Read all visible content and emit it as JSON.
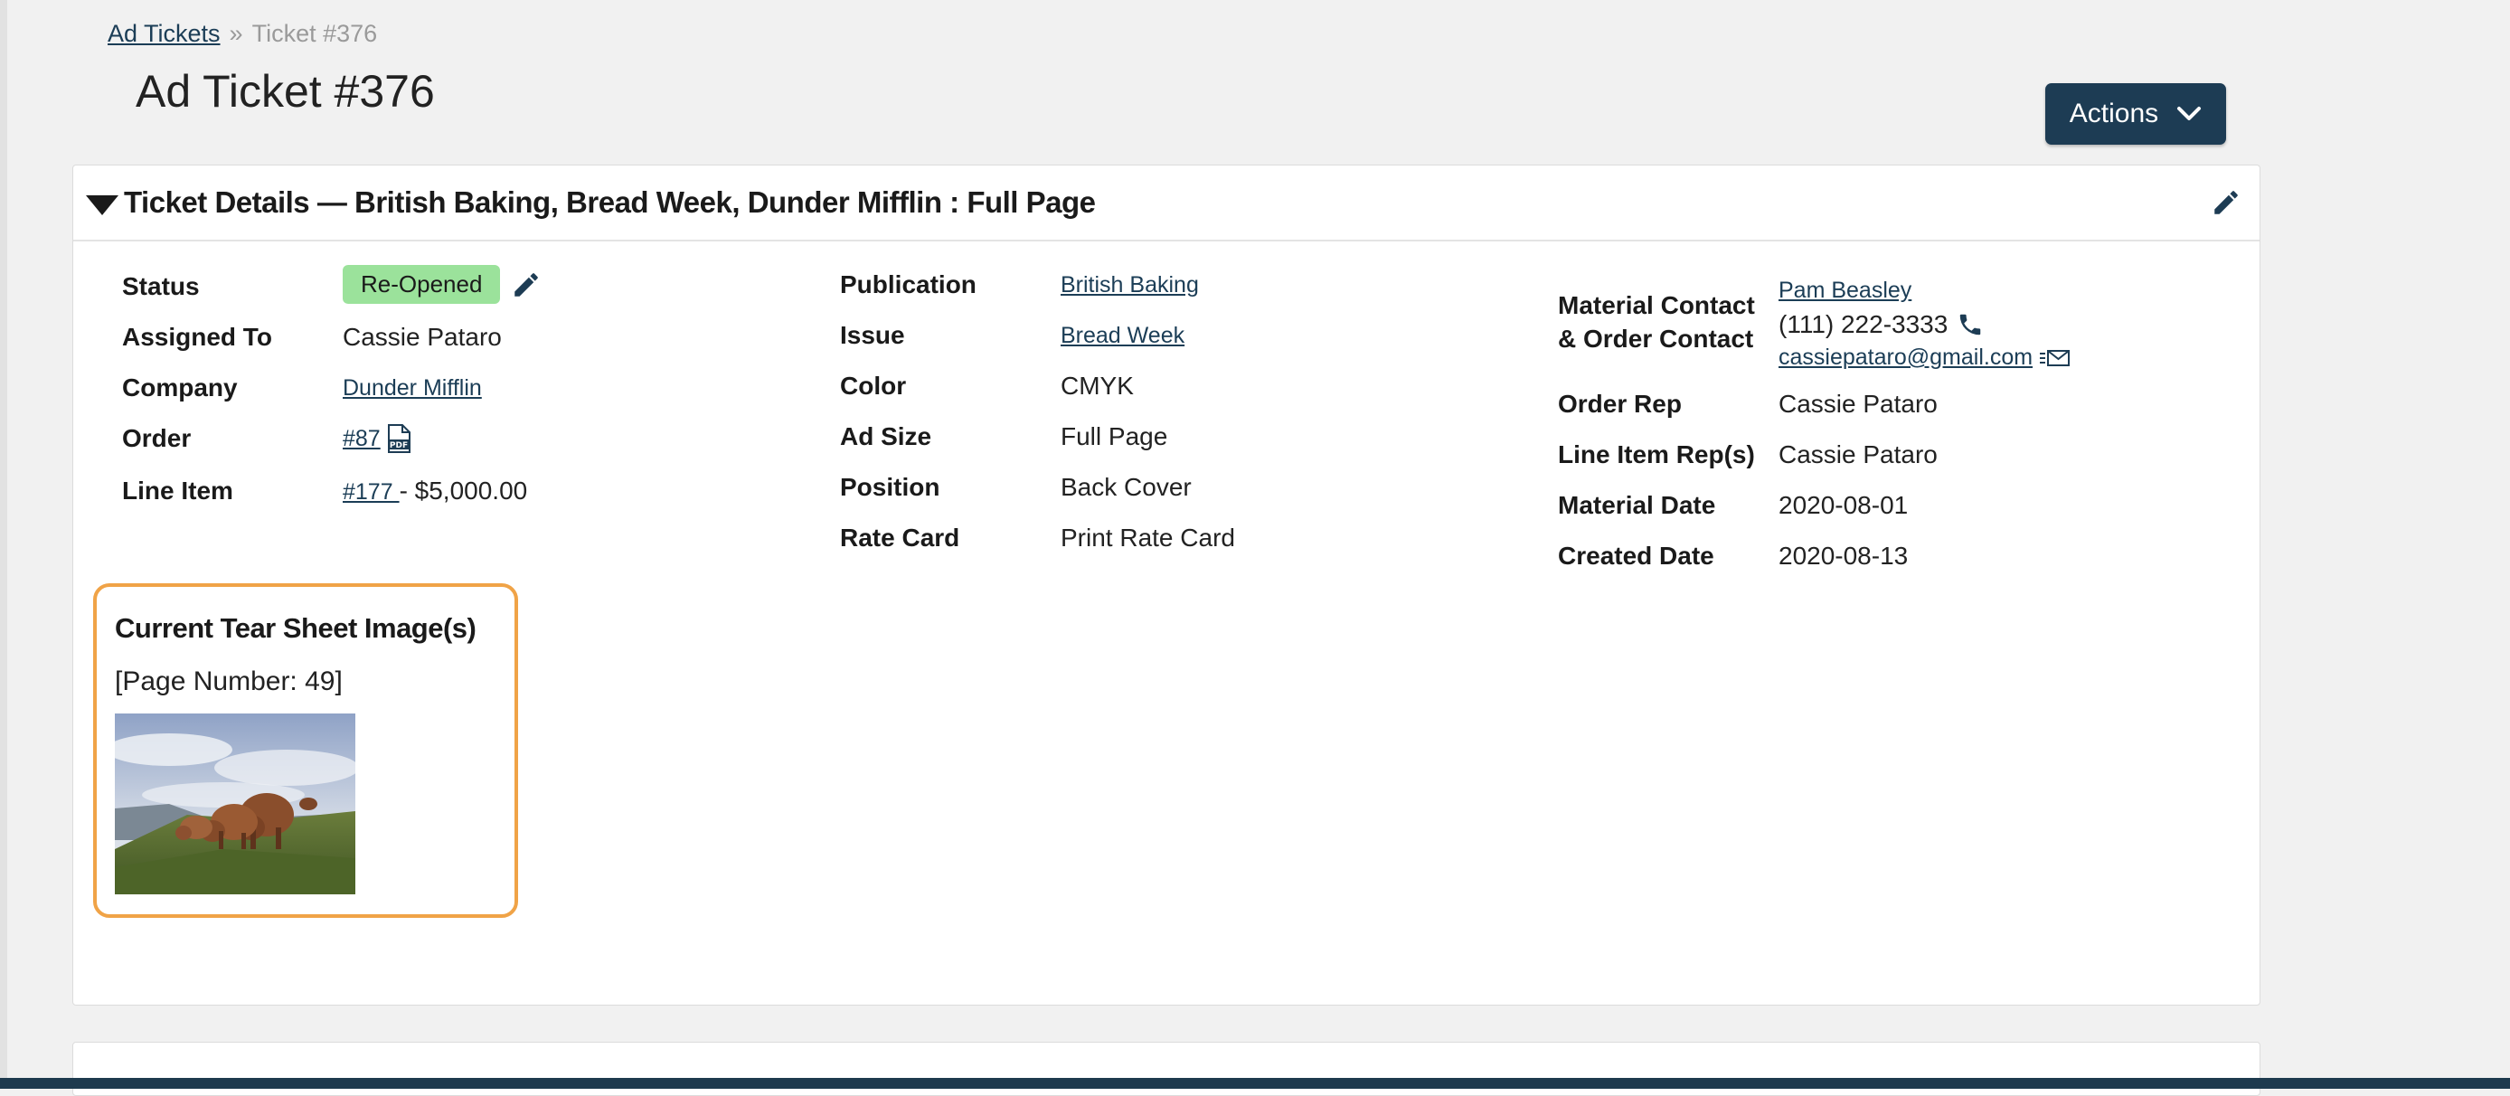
{
  "breadcrumb": {
    "parent": "Ad Tickets",
    "separator": "»",
    "current": "Ticket #376"
  },
  "page_title": "Ad Ticket #376",
  "actions_button": {
    "label": "Actions",
    "icon": "chevron-down-icon"
  },
  "panel": {
    "title": "Ticket Details — British Baking, Bread Week, Dunder Mifflin : Full Page"
  },
  "details": {
    "status": {
      "label": "Status",
      "value": "Re-Opened",
      "color": "#9be29b"
    },
    "assigned_to": {
      "label": "Assigned To",
      "value": "Cassie Pataro"
    },
    "company": {
      "label": "Company",
      "value": "Dunder Mifflin"
    },
    "order": {
      "label": "Order",
      "value": "#87",
      "icon": "pdf-icon"
    },
    "line_item": {
      "label": "Line Item",
      "link": "#177 ",
      "value": "- $5,000.00"
    },
    "publication": {
      "label": "Publication",
      "value": "British Baking"
    },
    "issue": {
      "label": "Issue",
      "value": "Bread Week"
    },
    "color": {
      "label": "Color",
      "value": "CMYK"
    },
    "ad_size": {
      "label": "Ad Size",
      "value": "Full Page"
    },
    "position": {
      "label": "Position",
      "value": "Back Cover"
    },
    "rate_card": {
      "label": "Rate Card",
      "value": "Print Rate Card"
    },
    "contact": {
      "label_line1": "Material Contact",
      "label_line2": "& Order Contact",
      "name": "Pam Beasley",
      "phone": "(111) 222-3333",
      "email": "cassiepataro@gmail.com"
    },
    "order_rep": {
      "label": "Order Rep",
      "value": "Cassie Pataro"
    },
    "line_item_reps": {
      "label": "Line Item Rep(s)",
      "value": "Cassie Pataro"
    },
    "material_date": {
      "label": "Material Date",
      "value": "2020-08-01"
    },
    "created_date": {
      "label": "Created Date",
      "value": "2020-08-13"
    }
  },
  "tear_sheet": {
    "title": "Current Tear Sheet Image(s)",
    "page_number": "[Page Number: 49]"
  },
  "colors": {
    "primary": "#1d3c54",
    "highlight": "#f0a347",
    "link": "#1b3d56"
  }
}
